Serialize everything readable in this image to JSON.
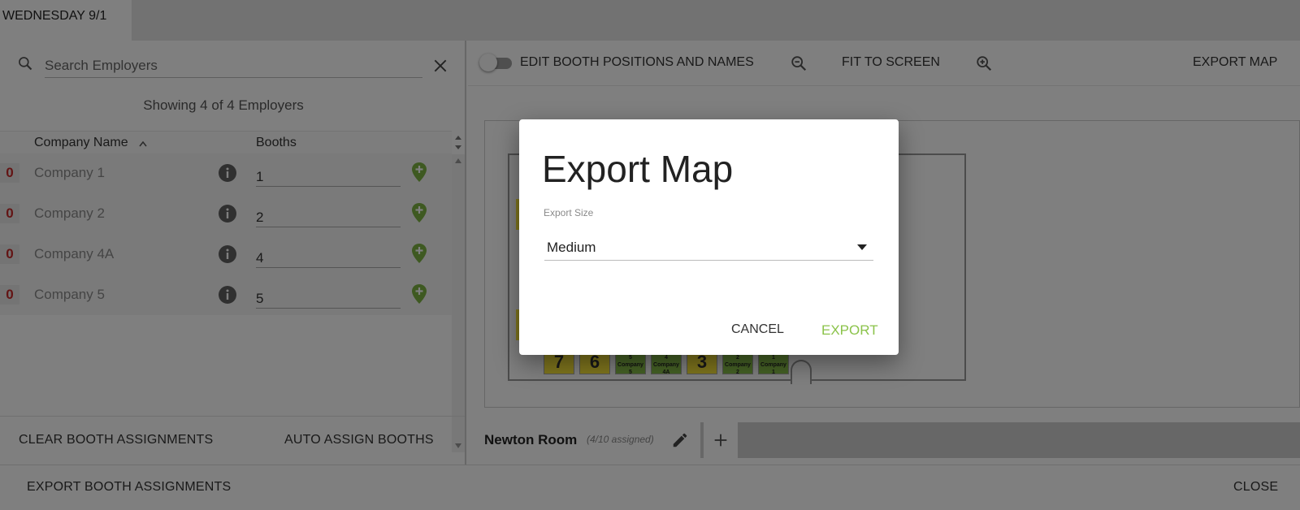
{
  "tabs": [
    {
      "label": "WEDNESDAY 9/1"
    }
  ],
  "search": {
    "placeholder": "Search Employers"
  },
  "showing_text": "Showing 4 of 4 Employers",
  "list": {
    "headers": {
      "company": "Company Name",
      "booths": "Booths"
    },
    "rows": [
      {
        "badge": "0",
        "company": "Company 1",
        "booth": "1"
      },
      {
        "badge": "0",
        "company": "Company 2",
        "booth": "2"
      },
      {
        "badge": "0",
        "company": "Company 4A",
        "booth": "4"
      },
      {
        "badge": "0",
        "company": "Company 5",
        "booth": "5"
      }
    ]
  },
  "left_actions": {
    "clear": "CLEAR BOOTH ASSIGNMENTS",
    "auto": "AUTO ASSIGN BOOTHS"
  },
  "toolbar": {
    "edit_label": "EDIT BOOTH POSITIONS AND NAMES",
    "fit_label": "FIT TO SCREEN",
    "export_map": "EXPORT MAP"
  },
  "map": {
    "booths": [
      {
        "label": "7",
        "status": "empty"
      },
      {
        "label": "6",
        "status": "empty"
      },
      {
        "label": "5 Company 5",
        "status": "assigned"
      },
      {
        "label": "4 Company 4A",
        "status": "assigned"
      },
      {
        "label": "3",
        "status": "empty"
      },
      {
        "label": "2 Company 2",
        "status": "assigned"
      },
      {
        "label": "1 Company 1",
        "status": "assigned"
      }
    ]
  },
  "room": {
    "name": "Newton Room",
    "count": "(4/10 assigned)"
  },
  "footer": {
    "export": "EXPORT BOOTH ASSIGNMENTS",
    "close": "CLOSE"
  },
  "dialog": {
    "title": "Export Map",
    "field_label": "Export Size",
    "selected": "Medium",
    "cancel": "CANCEL",
    "export": "EXPORT"
  },
  "colors": {
    "accent_green": "#8bc34a",
    "booth_empty": "#ffeb3b",
    "badge_red": "#c62828"
  }
}
